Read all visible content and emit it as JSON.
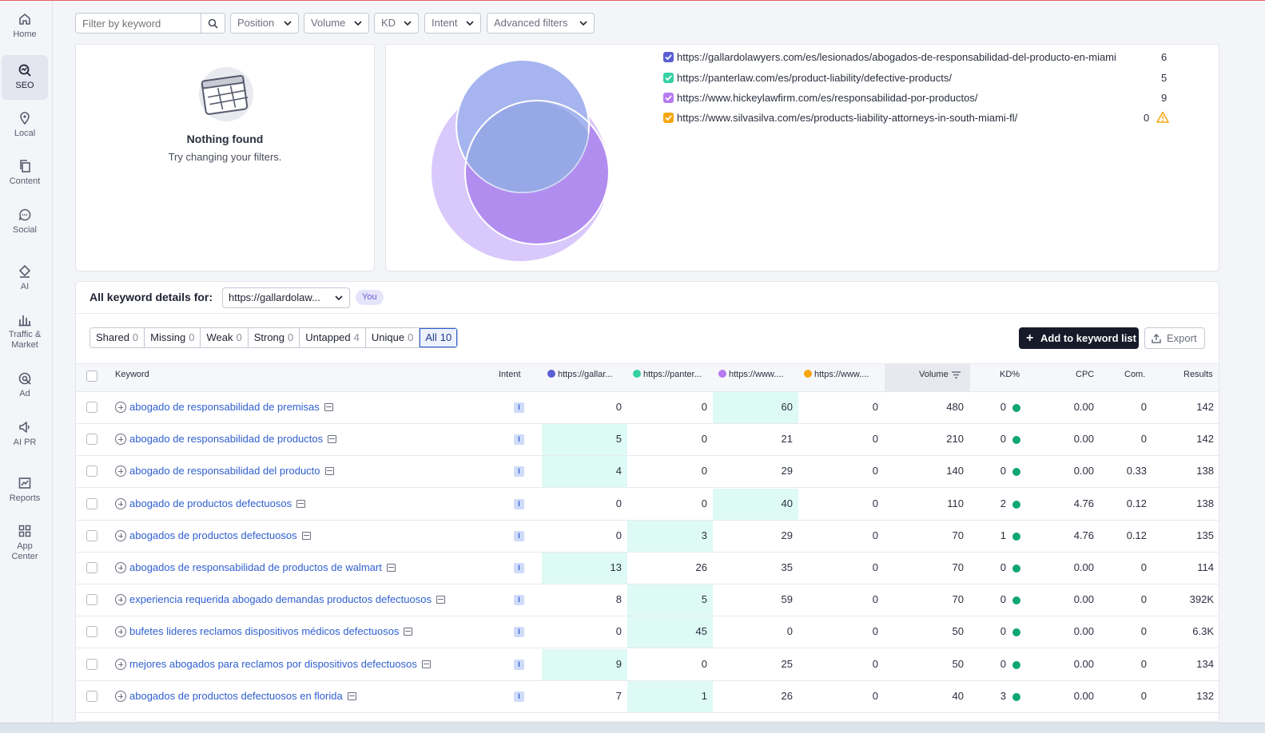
{
  "sidebar": {
    "items": [
      {
        "label": "Home",
        "icon": "home-icon"
      },
      {
        "label": "SEO",
        "icon": "seo-icon",
        "active": true
      },
      {
        "label": "Local",
        "icon": "location-pin-icon"
      },
      {
        "label": "Content",
        "icon": "content-icon"
      },
      {
        "label": "Social",
        "icon": "chat-bubble-icon"
      },
      {
        "label": "AI",
        "icon": "ai-icon"
      },
      {
        "label_line1": "Traffic &",
        "label_line2": "Market",
        "icon": "bar-chart-icon"
      },
      {
        "label": "Ad",
        "icon": "ad-target-icon"
      },
      {
        "label": "AI PR",
        "icon": "megaphone-icon"
      },
      {
        "label": "Reports",
        "icon": "reports-icon"
      },
      {
        "label_line1": "App",
        "label_line2": "Center",
        "icon": "app-grid-icon"
      }
    ]
  },
  "filters": {
    "search_placeholder": "Filter by keyword",
    "position": "Position",
    "volume": "Volume",
    "kd": "KD",
    "intent": "Intent",
    "advanced": "Advanced filters"
  },
  "empty_state": {
    "title": "Nothing found",
    "subtitle": "Try changing your filters."
  },
  "venn": {
    "domains": [
      {
        "url": "https://gallardolawyers.com/es/lesionados/abogados-de-responsabilidad-del-producto-en-miami",
        "count": "6",
        "color": "#5b5fd6"
      },
      {
        "url": "https://panterlaw.com/es/product-liability/defective-products/",
        "count": "5",
        "color": "#36d1a5"
      },
      {
        "url": "https://www.hickeylawfirm.com/es/responsabilidad-por-productos/",
        "count": "9",
        "color": "#b57af0"
      },
      {
        "url": "https://www.silvasilva.com/es/products-liability-attorneys-in-south-miami-fl/",
        "count": "0",
        "color": "#f5a70f",
        "warning": true
      }
    ]
  },
  "details": {
    "title": "All keyword details for:",
    "selected_domain": "https://gallardolaw...",
    "you_badge": "You",
    "segments": [
      {
        "label": "Shared",
        "count": "0"
      },
      {
        "label": "Missing",
        "count": "0"
      },
      {
        "label": "Weak",
        "count": "0"
      },
      {
        "label": "Strong",
        "count": "0"
      },
      {
        "label": "Untapped",
        "count": "4"
      },
      {
        "label": "Unique",
        "count": "0"
      },
      {
        "label": "All",
        "count": "10",
        "active": true
      }
    ],
    "add_button": "Add to keyword list",
    "export_button": "Export"
  },
  "table": {
    "headers": {
      "keyword": "Keyword",
      "intent": "Intent",
      "d1": "https://gallar...",
      "d2": "https://panter...",
      "d3": "https://www....",
      "d4": "https://www....",
      "volume": "Volume",
      "kd": "KD%",
      "cpc": "CPC",
      "com": "Com.",
      "results": "Results"
    },
    "rows": [
      {
        "keyword": "abogado de responsabilidad de premisas",
        "intent": "I",
        "d1": "0",
        "d2": "0",
        "d3": "60",
        "d4": "0",
        "volume": "480",
        "kd": "0",
        "cpc": "0.00",
        "com": "0",
        "results": "142",
        "hl": [
          false,
          false,
          true,
          false
        ]
      },
      {
        "keyword": "abogado de responsabilidad de productos",
        "intent": "I",
        "d1": "5",
        "d2": "0",
        "d3": "21",
        "d4": "0",
        "volume": "210",
        "kd": "0",
        "cpc": "0.00",
        "com": "0",
        "results": "142",
        "hl": [
          true,
          false,
          false,
          false
        ]
      },
      {
        "keyword": "abogado de responsabilidad del producto",
        "intent": "I",
        "d1": "4",
        "d2": "0",
        "d3": "29",
        "d4": "0",
        "volume": "140",
        "kd": "0",
        "cpc": "0.00",
        "com": "0.33",
        "results": "138",
        "hl": [
          true,
          false,
          false,
          false
        ]
      },
      {
        "keyword": "abogado de productos defectuosos",
        "intent": "I",
        "d1": "0",
        "d2": "0",
        "d3": "40",
        "d4": "0",
        "volume": "110",
        "kd": "2",
        "cpc": "4.76",
        "com": "0.12",
        "results": "138",
        "hl": [
          false,
          false,
          true,
          false
        ]
      },
      {
        "keyword": "abogados de productos defectuosos",
        "intent": "I",
        "d1": "0",
        "d2": "3",
        "d3": "29",
        "d4": "0",
        "volume": "70",
        "kd": "1",
        "cpc": "4.76",
        "com": "0.12",
        "results": "135",
        "hl": [
          false,
          true,
          false,
          false
        ]
      },
      {
        "keyword": "abogados de responsabilidad de productos de walmart",
        "intent": "I",
        "d1": "13",
        "d2": "26",
        "d3": "35",
        "d4": "0",
        "volume": "70",
        "kd": "0",
        "cpc": "0.00",
        "com": "0",
        "results": "114",
        "hl": [
          true,
          false,
          false,
          false
        ]
      },
      {
        "keyword": "experiencia requerida abogado demandas productos defectuosos",
        "intent": "I",
        "d1": "8",
        "d2": "5",
        "d3": "59",
        "d4": "0",
        "volume": "70",
        "kd": "0",
        "cpc": "0.00",
        "com": "0",
        "results": "392K",
        "hl": [
          false,
          true,
          false,
          false
        ]
      },
      {
        "keyword": "bufetes lideres reclamos dispositivos médicos defectuosos",
        "intent": "I",
        "d1": "0",
        "d2": "45",
        "d3": "0",
        "d4": "0",
        "volume": "50",
        "kd": "0",
        "cpc": "0.00",
        "com": "0",
        "results": "6.3K",
        "hl": [
          false,
          true,
          false,
          false
        ]
      },
      {
        "keyword": "mejores abogados para reclamos por dispositivos defectuosos",
        "intent": "I",
        "d1": "9",
        "d2": "0",
        "d3": "25",
        "d4": "0",
        "volume": "50",
        "kd": "0",
        "cpc": "0.00",
        "com": "0",
        "results": "134",
        "hl": [
          true,
          false,
          false,
          false
        ]
      },
      {
        "keyword": "abogados de productos defectuosos en florida",
        "intent": "I",
        "d1": "7",
        "d2": "1",
        "d3": "26",
        "d4": "0",
        "volume": "40",
        "kd": "3",
        "cpc": "0.00",
        "com": "0",
        "results": "132",
        "hl": [
          false,
          true,
          false,
          false
        ]
      }
    ]
  }
}
